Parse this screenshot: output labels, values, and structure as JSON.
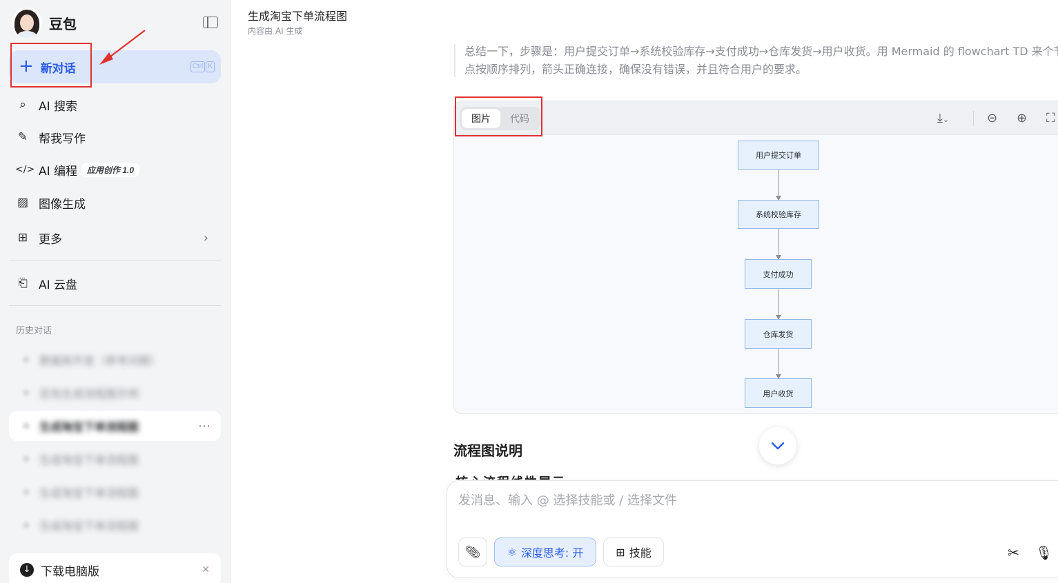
{
  "sidebar": {
    "brand": "豆包",
    "new_chat": {
      "label": "新对话",
      "shortcut": [
        "Ctrl",
        "K"
      ]
    },
    "nav": [
      {
        "label": "AI 搜索",
        "icon": "search-spark-icon"
      },
      {
        "label": "帮我写作",
        "icon": "pen-icon"
      },
      {
        "label": "AI 编程",
        "icon": "code-icon",
        "badge": "应用创作 1.0"
      },
      {
        "label": "图像生成",
        "icon": "image-icon"
      },
      {
        "label": "更多",
        "icon": "apps-icon"
      },
      {
        "label": "AI 云盘",
        "icon": "cloud-folder-icon"
      }
    ],
    "history_title": "历史对话",
    "history": [
      "数据库开发（参考问题）",
      "豆包生成流程图示例",
      "生成淘宝下单流程图",
      "生成淘宝下单流程图",
      "生成淘宝下单流程图",
      "生成淘宝下单流程图"
    ],
    "download_label": "下载电脑版"
  },
  "main": {
    "title": "生成淘宝下单流程图",
    "subtitle": "内容由 AI 生成",
    "summary": "总结一下，步骤是：用户提交订单→系统校验库存→支付成功→仓库发货→用户收货。用 Mermaid 的 flowchart TD 来个节点按顺序排列，箭头正确连接，确保没有错误，并且符合用户的要求。",
    "tabs": [
      "图片",
      "代码"
    ],
    "flow_nodes": [
      "用户提交订单",
      "系统校验库存",
      "支付成功",
      "仓库发货",
      "用户收货"
    ],
    "section_title": "流程图说明",
    "section_next": "核心流程线性展示"
  },
  "composer": {
    "placeholder": "发消息、输入 @ 选择技能或 / 选择文件",
    "deep_think": "深度思考: 开",
    "skills": "技能"
  },
  "colors": {
    "accent": "#2a5be8",
    "highlight": "#e03131"
  }
}
